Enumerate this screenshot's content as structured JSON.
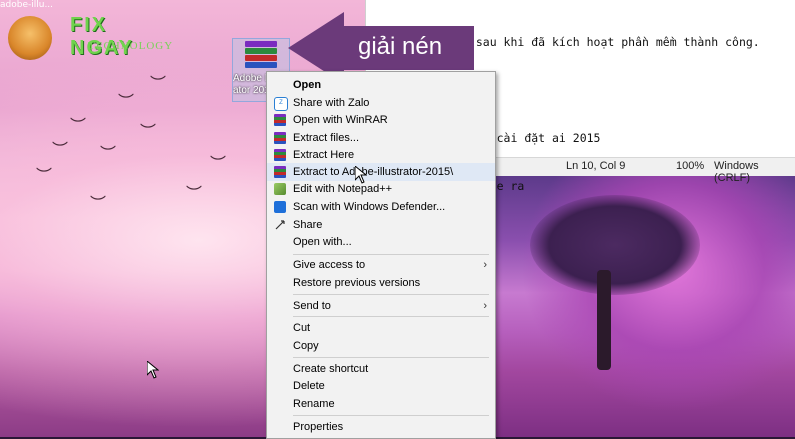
{
  "desktop": {
    "top_left_text": "adobe-illu...",
    "logo": {
      "name": "FIX NGAY",
      "tagline": "TECHNOLOGY"
    },
    "file": {
      "label_line1": "Adobe I",
      "label_line2": "ator 201"
    }
  },
  "notepad": {
    "lines": [
      "+ Không update sau khi đã kích hoạt phần mềm thành công.",
      "",
      "         iến hành cài đặt ai 2015",
      "         i nén file ra"
    ],
    "status": {
      "position": "Ln 10, Col 9",
      "zoom": "100%",
      "line_ending": "Windows (CRLF)"
    }
  },
  "annotation": {
    "text": "giải nén",
    "color": "#6b3a7a"
  },
  "context_menu": {
    "items": [
      {
        "id": "open",
        "label": "Open",
        "icon": "none",
        "bold": true
      },
      {
        "id": "share-zalo",
        "label": "Share with Zalo",
        "icon": "zalo-icon"
      },
      {
        "id": "open-winrar",
        "label": "Open with WinRAR",
        "icon": "winrar-icon"
      },
      {
        "id": "extract-files",
        "label": "Extract files...",
        "icon": "winrar-icon"
      },
      {
        "id": "extract-here",
        "label": "Extract Here",
        "icon": "winrar-icon"
      },
      {
        "id": "extract-to",
        "label": "Extract to Adobe-illustrator-2015\\",
        "icon": "winrar-icon",
        "hover": true
      },
      {
        "id": "edit-notepadpp",
        "label": "Edit with Notepad++",
        "icon": "notepadpp-icon"
      },
      {
        "id": "scan-defender",
        "label": "Scan with Windows Defender...",
        "icon": "defender-icon"
      },
      {
        "id": "share",
        "label": "Share",
        "icon": "share-icon"
      },
      {
        "id": "open-with",
        "label": "Open with...",
        "icon": "none"
      },
      {
        "id": "give-access",
        "label": "Give access to",
        "icon": "none",
        "submenu": true
      },
      {
        "id": "restore-prev",
        "label": "Restore previous versions",
        "icon": "none"
      },
      {
        "id": "send-to",
        "label": "Send to",
        "icon": "none",
        "submenu": true
      },
      {
        "id": "cut",
        "label": "Cut",
        "icon": "none"
      },
      {
        "id": "copy",
        "label": "Copy",
        "icon": "none"
      },
      {
        "id": "create-shortcut",
        "label": "Create shortcut",
        "icon": "none"
      },
      {
        "id": "delete",
        "label": "Delete",
        "icon": "none"
      },
      {
        "id": "rename",
        "label": "Rename",
        "icon": "none"
      },
      {
        "id": "properties",
        "label": "Properties",
        "icon": "none"
      }
    ]
  },
  "colors": {
    "menu_bg": "#f2f2f2",
    "menu_hover": "#dfe8f5",
    "logo_green": "#6fd34c"
  }
}
